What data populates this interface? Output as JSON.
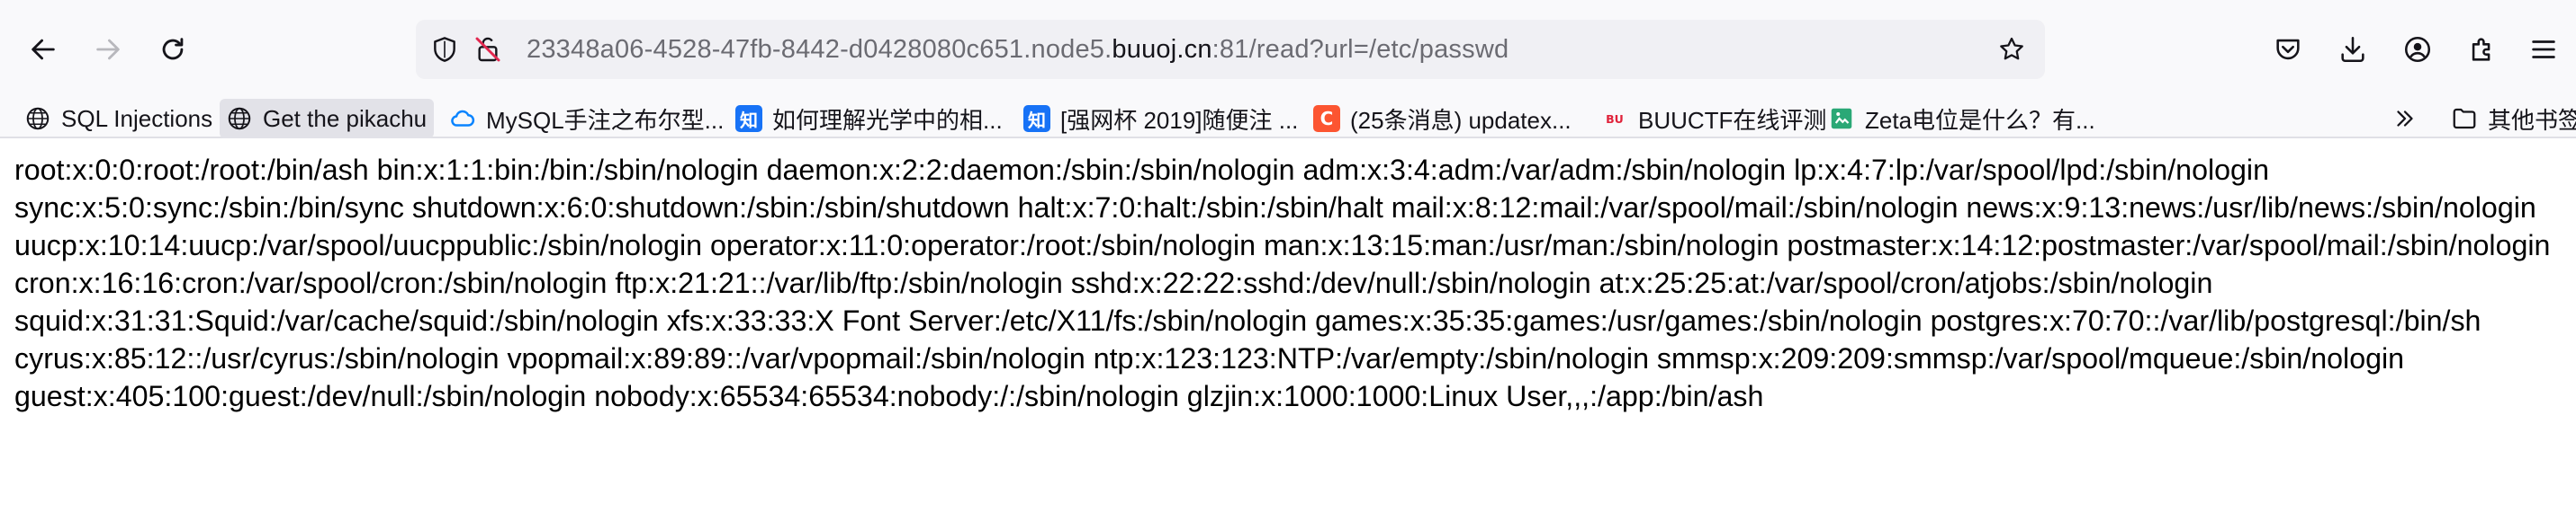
{
  "toolbar": {
    "back_icon": "arrow-left-icon",
    "forward_icon": "arrow-right-icon",
    "reload_icon": "reload-icon",
    "url": {
      "prefix": "23348a06-4528-47fb-8442-d0428080c651.node5.",
      "domain": "buuoj.cn",
      "suffix": ":81/read?url=/etc/passwd"
    },
    "right_icons": [
      "pocket-icon",
      "download-icon",
      "account-icon",
      "extensions-icon",
      "menu-icon"
    ]
  },
  "bookmarks": [
    {
      "label": "SQL Injections",
      "icon": "globe-icon"
    },
    {
      "label": "Get the pikachu",
      "icon": "globe-icon"
    },
    {
      "label": "MySQL手注之布尔型...",
      "icon": "cloud-icon"
    },
    {
      "label": "如何理解光学中的相...",
      "icon": "zhihu-icon"
    },
    {
      "label": "[强网杯 2019]随便注 ...",
      "icon": "zhihu-icon"
    },
    {
      "label": "(25条消息) updatex...",
      "icon": "csdn-icon"
    },
    {
      "label": "BUUCTF在线评测",
      "icon": "buuctf-icon"
    },
    {
      "label": "Zeta电位是什么？有...",
      "icon": "image-icon"
    },
    {
      "label": "其他书签",
      "icon": "folder-icon"
    }
  ],
  "colors": {
    "zhihu": "#1772f6",
    "csdn": "#fc5531",
    "buuctf": "#e0223a",
    "cloud": "#0a84ff"
  },
  "page": {
    "body_text": "root:x:0:0:root:/root:/bin/ash bin:x:1:1:bin:/bin:/sbin/nologin daemon:x:2:2:daemon:/sbin:/sbin/nologin adm:x:3:4:adm:/var/adm:/sbin/nologin lp:x:4:7:lp:/var/spool/lpd:/sbin/nologin sync:x:5:0:sync:/sbin:/bin/sync shutdown:x:6:0:shutdown:/sbin:/sbin/shutdown halt:x:7:0:halt:/sbin:/sbin/halt mail:x:8:12:mail:/var/spool/mail:/sbin/nologin news:x:9:13:news:/usr/lib/news:/sbin/nologin uucp:x:10:14:uucp:/var/spool/uucppublic:/sbin/nologin operator:x:11:0:operator:/root:/sbin/nologin man:x:13:15:man:/usr/man:/sbin/nologin postmaster:x:14:12:postmaster:/var/spool/mail:/sbin/nologin cron:x:16:16:cron:/var/spool/cron:/sbin/nologin ftp:x:21:21::/var/lib/ftp:/sbin/nologin sshd:x:22:22:sshd:/dev/null:/sbin/nologin at:x:25:25:at:/var/spool/cron/atjobs:/sbin/nologin squid:x:31:31:Squid:/var/cache/squid:/sbin/nologin xfs:x:33:33:X Font Server:/etc/X11/fs:/sbin/nologin games:x:35:35:games:/usr/games:/sbin/nologin postgres:x:70:70::/var/lib/postgresql:/bin/sh cyrus:x:85:12::/usr/cyrus:/sbin/nologin vpopmail:x:89:89::/var/vpopmail:/sbin/nologin ntp:x:123:123:NTP:/var/empty:/sbin/nologin smmsp:x:209:209:smmsp:/var/spool/mqueue:/sbin/nologin guest:x:405:100:guest:/dev/null:/sbin/nologin nobody:x:65534:65534:nobody:/:/sbin/nologin glzjin:x:1000:1000:Linux User,,,:/app:/bin/ash"
  }
}
